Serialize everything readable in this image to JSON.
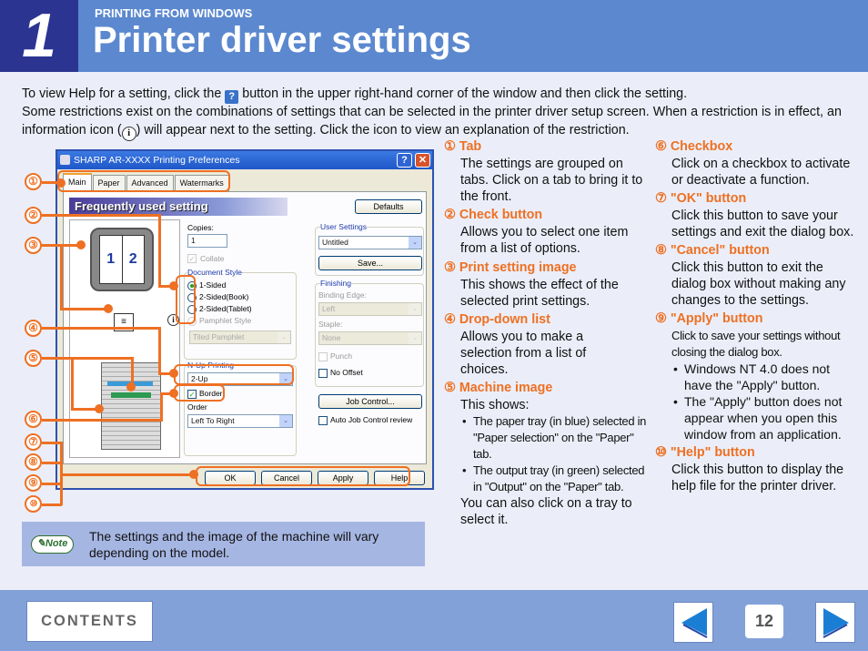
{
  "header": {
    "chapter_number": "1",
    "section": "PRINTING FROM WINDOWS",
    "title": "Printer driver settings"
  },
  "intro": {
    "line1_before": "To view Help for a setting, click the",
    "line1_after": "button in the upper right-hand corner of the window and then click the setting.",
    "help_icon_glyph": "?",
    "line2_before": "Some restrictions exist on the combinations of settings that can be selected in the printer driver setup screen. When a restriction is in effect, an information icon (",
    "info_icon_glyph": "i",
    "line2_after": ") will appear next to the setting. Click the icon to view an explanation of the restriction."
  },
  "dialog": {
    "title": "SHARP AR-XXXX Printing Preferences",
    "help_btn": "?",
    "close_btn": "✕",
    "tabs": [
      "Main",
      "Paper",
      "Advanced",
      "Watermarks"
    ],
    "banner": "Frequently used setting",
    "defaults_btn": "Defaults",
    "preview_pages": [
      "1",
      "2"
    ],
    "copies_label": "Copies:",
    "copies_value": "1",
    "collate_label": "Collate",
    "document_style_label": "Document Style",
    "doc_styles": [
      "1-Sided",
      "2-Sided(Book)",
      "2-Sided(Tablet)",
      "Pamphlet Style"
    ],
    "pamphlet_value": "Tiled Pamphlet",
    "nup_label": "N-Up Printing",
    "nup_value": "2-Up",
    "border_label": "Border",
    "order_label": "Order",
    "order_value": "Left To Right",
    "user_settings_label": "User Settings",
    "user_settings_value": "Untitled",
    "save_btn": "Save...",
    "finishing_label": "Finishing",
    "binding_edge_label": "Binding Edge:",
    "binding_edge_value": "Left",
    "staple_label": "Staple:",
    "staple_value": "None",
    "punch_label": "Punch",
    "no_offset_label": "No Offset",
    "job_control_btn": "Job Control...",
    "auto_job_label": "Auto Job Control review",
    "ok_btn": "OK",
    "cancel_btn": "Cancel",
    "apply_btn": "Apply",
    "help_btn_label": "Help",
    "dropdown_glyph": "⌄",
    "check_glyph": "✓"
  },
  "callouts": [
    "①",
    "②",
    "③",
    "④",
    "⑤",
    "⑥",
    "⑦",
    "⑧",
    "⑨",
    "⑩"
  ],
  "items": [
    {
      "num": "①",
      "title": "Tab",
      "text": "The settings are grouped on tabs. Click on a tab to bring it to the front."
    },
    {
      "num": "②",
      "title": "Check button",
      "text": "Allows you to select one item from a list of options."
    },
    {
      "num": "③",
      "title": "Print setting image",
      "text": "This shows the effect of the selected print settings."
    },
    {
      "num": "④",
      "title": "Drop-down list",
      "text": "Allows you to make a selection from a list of choices."
    },
    {
      "num": "⑤",
      "title": "Machine image",
      "text": "This shows:",
      "bullets": [
        "The paper tray (in blue) selected in \"Paper selection\" on the \"Paper\" tab.",
        "The output tray (in green) selected in \"Output\" on the \"Paper\" tab."
      ],
      "text2": "You can also click on a tray to select it."
    },
    {
      "num": "⑥",
      "title": "Checkbox",
      "text": "Click on a checkbox to activate or deactivate a function."
    },
    {
      "num": "⑦",
      "title": "\"OK\" button",
      "text": "Click this button to save your settings and exit the dialog box."
    },
    {
      "num": "⑧",
      "title": "\"Cancel\" button",
      "text": "Click this button to exit the dialog box without making any changes to the settings."
    },
    {
      "num": "⑨",
      "title": "\"Apply\" button",
      "text": "Click to save your settings without closing the dialog box.",
      "bullets": [
        "Windows NT 4.0 does not have the \"Apply\" button.",
        "The \"Apply\" button does not appear when you open this window from an application."
      ]
    },
    {
      "num": "⑩",
      "title": "\"Help\" button",
      "text": "Click this button to display the help file for the printer driver."
    }
  ],
  "note": {
    "badge": "Note",
    "text": "The settings and the image of the machine will vary depending on the model."
  },
  "footer": {
    "contents_label": "CONTENTS",
    "page_number": "12"
  },
  "colors": {
    "header_blue": "#5b88cf",
    "chapter_navy": "#2b3491",
    "accent_orange": "#ee7023",
    "note_bg": "#a6b6e3",
    "footer_bg": "#83a1d9"
  }
}
